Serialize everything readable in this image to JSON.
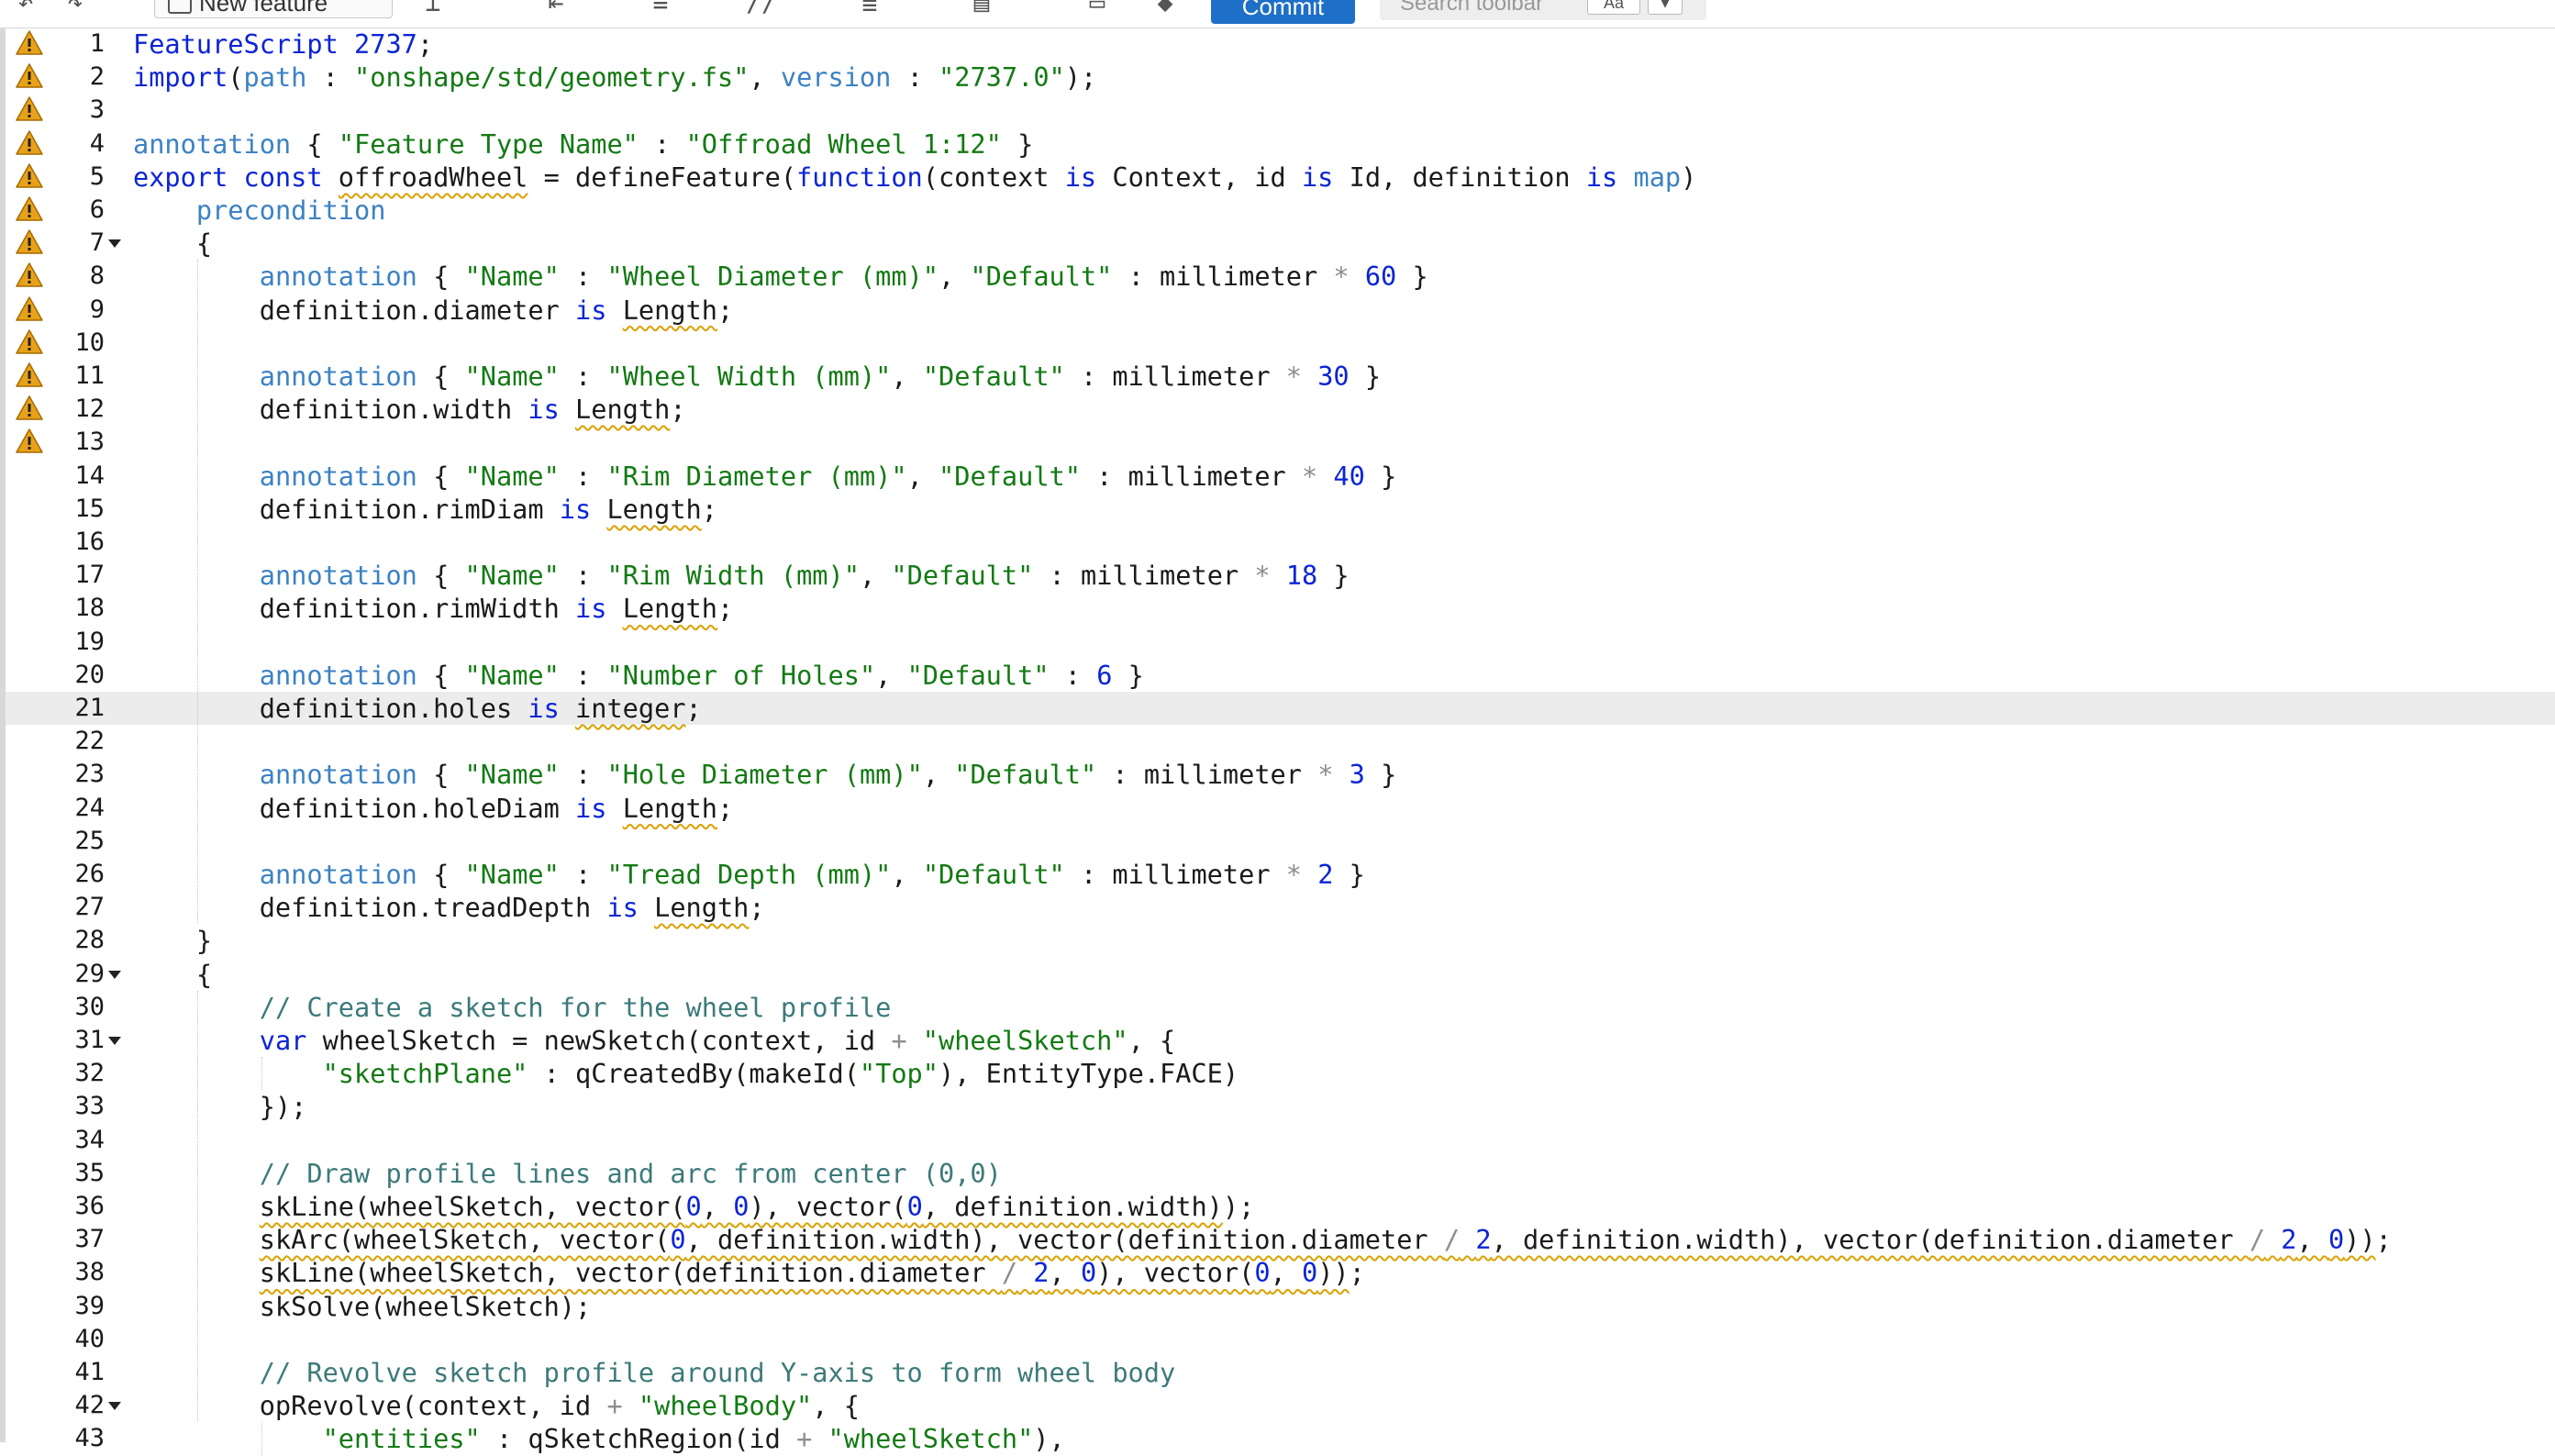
{
  "toolbar": {
    "new_feature_label": "New feature",
    "commit_label": "Commit",
    "search_placeholder": "Search toolbar",
    "search_option_1": "Aa",
    "search_option_2": "▾"
  },
  "editor": {
    "active_line": 21,
    "warning_color": "#e8a21a",
    "lines": [
      {
        "n": "1",
        "tokens": [
          [
            "FeatureScript ",
            "kw"
          ],
          [
            "2737",
            "num"
          ],
          [
            ";",
            ""
          ]
        ]
      },
      {
        "n": "2",
        "tokens": [
          [
            "import",
            "kw"
          ],
          [
            "(",
            ""
          ],
          [
            "path",
            "ann"
          ],
          [
            " : ",
            ""
          ],
          [
            "\"onshape/std/geometry.fs\"",
            "str"
          ],
          [
            ", ",
            ""
          ],
          [
            "version",
            "ann"
          ],
          [
            " : ",
            ""
          ],
          [
            "\"2737.0\"",
            "str"
          ],
          [
            ");",
            ""
          ]
        ]
      },
      {
        "n": "3",
        "tokens": []
      },
      {
        "n": "4",
        "tokens": [
          [
            "annotation",
            "ann"
          ],
          [
            " { ",
            ""
          ],
          [
            "\"Feature Type Name\"",
            "str"
          ],
          [
            " : ",
            ""
          ],
          [
            "\"Offroad Wheel 1:12\"",
            "str"
          ],
          [
            " }",
            ""
          ]
        ]
      },
      {
        "n": "5",
        "tokens": [
          [
            "export const ",
            "kw"
          ],
          [
            "offroadWheel",
            "sq"
          ],
          [
            " = defineFeature(",
            ""
          ],
          [
            "function",
            "kw"
          ],
          [
            "(context ",
            ""
          ],
          [
            "is",
            "kw"
          ],
          [
            " Context, id ",
            ""
          ],
          [
            "is",
            "kw"
          ],
          [
            " Id, definition ",
            ""
          ],
          [
            "is",
            "kw"
          ],
          [
            " ",
            ""
          ],
          [
            "map",
            "ann"
          ],
          [
            ")",
            ""
          ]
        ]
      },
      {
        "n": "6",
        "tokens": [
          [
            "    ",
            ""
          ],
          [
            "precondition",
            "ann"
          ]
        ]
      },
      {
        "n": "7",
        "fold": true,
        "tokens": [
          [
            "    {",
            ""
          ]
        ]
      },
      {
        "n": "8",
        "tokens": [
          [
            "        ",
            ""
          ],
          [
            "annotation",
            "ann"
          ],
          [
            " { ",
            ""
          ],
          [
            "\"Name\"",
            "str"
          ],
          [
            " : ",
            ""
          ],
          [
            "\"Wheel Diameter (mm)\"",
            "str"
          ],
          [
            ", ",
            ""
          ],
          [
            "\"Default\"",
            "str"
          ],
          [
            " : millimeter ",
            ""
          ],
          [
            "*",
            "op"
          ],
          [
            " ",
            ""
          ],
          [
            "60",
            "num"
          ],
          [
            " }",
            ""
          ]
        ]
      },
      {
        "n": "9",
        "tokens": [
          [
            "        definition.diameter ",
            ""
          ],
          [
            "is",
            "kw"
          ],
          [
            " ",
            ""
          ],
          [
            "Length",
            "sq"
          ],
          [
            ";",
            ""
          ]
        ]
      },
      {
        "n": "10",
        "tokens": []
      },
      {
        "n": "11",
        "tokens": [
          [
            "        ",
            ""
          ],
          [
            "annotation",
            "ann"
          ],
          [
            " { ",
            ""
          ],
          [
            "\"Name\"",
            "str"
          ],
          [
            " : ",
            ""
          ],
          [
            "\"Wheel Width (mm)\"",
            "str"
          ],
          [
            ", ",
            ""
          ],
          [
            "\"Default\"",
            "str"
          ],
          [
            " : millimeter ",
            ""
          ],
          [
            "*",
            "op"
          ],
          [
            " ",
            ""
          ],
          [
            "30",
            "num"
          ],
          [
            " }",
            ""
          ]
        ]
      },
      {
        "n": "12",
        "tokens": [
          [
            "        definition.width ",
            ""
          ],
          [
            "is",
            "kw"
          ],
          [
            " ",
            ""
          ],
          [
            "Length",
            "sq"
          ],
          [
            ";",
            ""
          ]
        ]
      },
      {
        "n": "13",
        "tokens": []
      },
      {
        "n": "14",
        "tokens": [
          [
            "        ",
            ""
          ],
          [
            "annotation",
            "ann"
          ],
          [
            " { ",
            ""
          ],
          [
            "\"Name\"",
            "str"
          ],
          [
            " : ",
            ""
          ],
          [
            "\"Rim Diameter (mm)\"",
            "str"
          ],
          [
            ", ",
            ""
          ],
          [
            "\"Default\"",
            "str"
          ],
          [
            " : millimeter ",
            ""
          ],
          [
            "*",
            "op"
          ],
          [
            " ",
            ""
          ],
          [
            "40",
            "num"
          ],
          [
            " }",
            ""
          ]
        ]
      },
      {
        "n": "15",
        "tokens": [
          [
            "        definition.rimDiam ",
            ""
          ],
          [
            "is",
            "kw"
          ],
          [
            " ",
            ""
          ],
          [
            "Length",
            "sq"
          ],
          [
            ";",
            ""
          ]
        ]
      },
      {
        "n": "16",
        "tokens": []
      },
      {
        "n": "17",
        "tokens": [
          [
            "        ",
            ""
          ],
          [
            "annotation",
            "ann"
          ],
          [
            " { ",
            ""
          ],
          [
            "\"Name\"",
            "str"
          ],
          [
            " : ",
            ""
          ],
          [
            "\"Rim Width (mm)\"",
            "str"
          ],
          [
            ", ",
            ""
          ],
          [
            "\"Default\"",
            "str"
          ],
          [
            " : millimeter ",
            ""
          ],
          [
            "*",
            "op"
          ],
          [
            " ",
            ""
          ],
          [
            "18",
            "num"
          ],
          [
            " }",
            ""
          ]
        ]
      },
      {
        "n": "18",
        "tokens": [
          [
            "        definition.rimWidth ",
            ""
          ],
          [
            "is",
            "kw"
          ],
          [
            " ",
            ""
          ],
          [
            "Length",
            "sq"
          ],
          [
            ";",
            ""
          ]
        ]
      },
      {
        "n": "19",
        "tokens": []
      },
      {
        "n": "20",
        "tokens": [
          [
            "        ",
            ""
          ],
          [
            "annotation",
            "ann"
          ],
          [
            " { ",
            ""
          ],
          [
            "\"Name\"",
            "str"
          ],
          [
            " : ",
            ""
          ],
          [
            "\"Number of Holes\"",
            "str"
          ],
          [
            ", ",
            ""
          ],
          [
            "\"Default\"",
            "str"
          ],
          [
            " : ",
            ""
          ],
          [
            "6",
            "num"
          ],
          [
            " }",
            ""
          ]
        ]
      },
      {
        "n": "21",
        "tokens": [
          [
            "        definition.holes ",
            ""
          ],
          [
            "is",
            "kw"
          ],
          [
            " ",
            ""
          ],
          [
            "integer",
            "sq"
          ],
          [
            ";",
            ""
          ]
        ]
      },
      {
        "n": "22",
        "tokens": []
      },
      {
        "n": "23",
        "tokens": [
          [
            "        ",
            ""
          ],
          [
            "annotation",
            "ann"
          ],
          [
            " { ",
            ""
          ],
          [
            "\"Name\"",
            "str"
          ],
          [
            " : ",
            ""
          ],
          [
            "\"Hole Diameter (mm)\"",
            "str"
          ],
          [
            ", ",
            ""
          ],
          [
            "\"Default\"",
            "str"
          ],
          [
            " : millimeter ",
            ""
          ],
          [
            "*",
            "op"
          ],
          [
            " ",
            ""
          ],
          [
            "3",
            "num"
          ],
          [
            " }",
            ""
          ]
        ]
      },
      {
        "n": "24",
        "tokens": [
          [
            "        definition.holeDiam ",
            ""
          ],
          [
            "is",
            "kw"
          ],
          [
            " ",
            ""
          ],
          [
            "Length",
            "sq"
          ],
          [
            ";",
            ""
          ]
        ]
      },
      {
        "n": "25",
        "tokens": []
      },
      {
        "n": "26",
        "tokens": [
          [
            "        ",
            ""
          ],
          [
            "annotation",
            "ann"
          ],
          [
            " { ",
            ""
          ],
          [
            "\"Name\"",
            "str"
          ],
          [
            " : ",
            ""
          ],
          [
            "\"Tread Depth (mm)\"",
            "str"
          ],
          [
            ", ",
            ""
          ],
          [
            "\"Default\"",
            "str"
          ],
          [
            " : millimeter ",
            ""
          ],
          [
            "*",
            "op"
          ],
          [
            " ",
            ""
          ],
          [
            "2",
            "num"
          ],
          [
            " }",
            ""
          ]
        ]
      },
      {
        "n": "27",
        "tokens": [
          [
            "        definition.treadDepth ",
            ""
          ],
          [
            "is",
            "kw"
          ],
          [
            " ",
            ""
          ],
          [
            "Length",
            "sq"
          ],
          [
            ";",
            ""
          ]
        ]
      },
      {
        "n": "28",
        "tokens": [
          [
            "    }",
            ""
          ]
        ]
      },
      {
        "n": "29",
        "fold": true,
        "tokens": [
          [
            "    {",
            ""
          ]
        ]
      },
      {
        "n": "30",
        "tokens": [
          [
            "        ",
            ""
          ],
          [
            "// Create a sketch for the wheel profile",
            "cm"
          ]
        ]
      },
      {
        "n": "31",
        "fold": true,
        "tokens": [
          [
            "        ",
            ""
          ],
          [
            "var",
            "kw"
          ],
          [
            " wheelSketch = newSketch(context, id ",
            ""
          ],
          [
            "+",
            "op"
          ],
          [
            " ",
            ""
          ],
          [
            "\"wheelSketch\"",
            "str"
          ],
          [
            ", {",
            ""
          ]
        ]
      },
      {
        "n": "32",
        "tokens": [
          [
            "            ",
            ""
          ],
          [
            "\"sketchPlane\"",
            "str"
          ],
          [
            " : qCreatedBy(makeId(",
            ""
          ],
          [
            "\"Top\"",
            "str"
          ],
          [
            "), EntityType.FACE)",
            ""
          ]
        ]
      },
      {
        "n": "33",
        "tokens": [
          [
            "        });",
            ""
          ]
        ]
      },
      {
        "n": "34",
        "tokens": []
      },
      {
        "n": "35",
        "tokens": [
          [
            "        ",
            ""
          ],
          [
            "// Draw profile lines and arc from center (0,0)",
            "cm"
          ]
        ]
      },
      {
        "n": "36",
        "tokens": [
          [
            "        ",
            ""
          ],
          [
            "skLine(wheelSketch, vector(",
            "sq"
          ],
          [
            "0",
            "sq num"
          ],
          [
            ", ",
            "sq"
          ],
          [
            "0",
            "sq num"
          ],
          [
            "), vector(",
            "sq"
          ],
          [
            "0",
            "sq num"
          ],
          [
            ", definition.width)",
            "sq"
          ],
          [
            ");",
            ""
          ]
        ]
      },
      {
        "n": "37",
        "tokens": [
          [
            "        ",
            ""
          ],
          [
            "skArc(wheelSketch, vector(",
            "sq"
          ],
          [
            "0",
            "sq num"
          ],
          [
            ", definition.width), vector(definition.diameter ",
            "sq"
          ],
          [
            "/",
            "sq op"
          ],
          [
            " ",
            "sq"
          ],
          [
            "2",
            "sq num"
          ],
          [
            ", definition.width), vector(definition.diameter ",
            "sq"
          ],
          [
            "/",
            "sq op"
          ],
          [
            " ",
            "sq"
          ],
          [
            "2",
            "sq num"
          ],
          [
            ", ",
            "sq"
          ],
          [
            "0",
            "sq num"
          ],
          [
            "))",
            "sq"
          ],
          [
            ";",
            ""
          ]
        ]
      },
      {
        "n": "38",
        "tokens": [
          [
            "        ",
            ""
          ],
          [
            "skLine(wheelSketch, vector(definition.diameter ",
            "sq"
          ],
          [
            "/",
            "sq op"
          ],
          [
            " ",
            "sq"
          ],
          [
            "2",
            "sq num"
          ],
          [
            ", ",
            "sq"
          ],
          [
            "0",
            "sq num"
          ],
          [
            "), vector(",
            "sq"
          ],
          [
            "0",
            "sq num"
          ],
          [
            ", ",
            "sq"
          ],
          [
            "0",
            "sq num"
          ],
          [
            "))",
            "sq"
          ],
          [
            ";",
            ""
          ]
        ]
      },
      {
        "n": "39",
        "tokens": [
          [
            "        skSolve(wheelSketch);",
            ""
          ]
        ]
      },
      {
        "n": "40",
        "tokens": []
      },
      {
        "n": "41",
        "tokens": [
          [
            "        ",
            ""
          ],
          [
            "// Revolve sketch profile around Y-axis to form wheel body",
            "cm"
          ]
        ]
      },
      {
        "n": "42",
        "fold": true,
        "tokens": [
          [
            "        opRevolve(context, id ",
            ""
          ],
          [
            "+",
            "op"
          ],
          [
            " ",
            ""
          ],
          [
            "\"wheelBody\"",
            "str"
          ],
          [
            ", {",
            ""
          ]
        ]
      },
      {
        "n": "43",
        "tokens": [
          [
            "            ",
            ""
          ],
          [
            "\"entities\"",
            "str"
          ],
          [
            " : qSketchRegion(id ",
            ""
          ],
          [
            "+",
            "op"
          ],
          [
            " ",
            ""
          ],
          [
            "\"wheelSketch\"",
            "str"
          ],
          [
            "),",
            ""
          ]
        ]
      }
    ]
  }
}
